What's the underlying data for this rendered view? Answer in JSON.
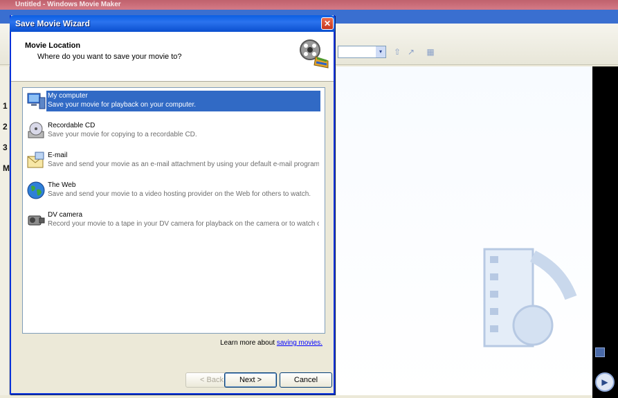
{
  "app": {
    "title": "Untitled - Windows Movie Maker",
    "step_numbers": [
      "1",
      "2",
      "3"
    ],
    "left_letter": "M",
    "combo_arrow": "▾",
    "toolbar_icons": [
      "up-folder-icon",
      "new-folder-icon",
      "views-icon"
    ]
  },
  "dialog": {
    "title": "Save Movie Wizard",
    "close_label": "✕",
    "header": {
      "title": "Movie Location",
      "subtitle": "Where do you want to save your movie to?"
    },
    "options": [
      {
        "label": "My computer",
        "description": "Save your movie for playback on your computer.",
        "icon": "computer-icon",
        "selected": true
      },
      {
        "label": "Recordable CD",
        "description": "Save your movie for copying to a recordable CD.",
        "icon": "cd-drive-icon",
        "selected": false
      },
      {
        "label": "E-mail",
        "description": "Save and send your movie as an e-mail attachment by using your default e-mail program.",
        "icon": "email-icon",
        "selected": false
      },
      {
        "label": "The Web",
        "description": "Save and send your movie to a video hosting provider on the Web for others to watch.",
        "icon": "globe-icon",
        "selected": false
      },
      {
        "label": "DV camera",
        "description": "Record your movie to a tape in your DV camera for playback on the camera or to watch o...",
        "icon": "dv-camera-icon",
        "selected": false
      }
    ],
    "learn_more_prefix": "Learn more about",
    "learn_more_link": "saving movies.",
    "buttons": {
      "back": "< Back",
      "next": "Next >",
      "cancel": "Cancel"
    }
  },
  "colors": {
    "selection": "#316ac5",
    "titlebar": "#0a5fe3",
    "link": "#0000ff"
  }
}
